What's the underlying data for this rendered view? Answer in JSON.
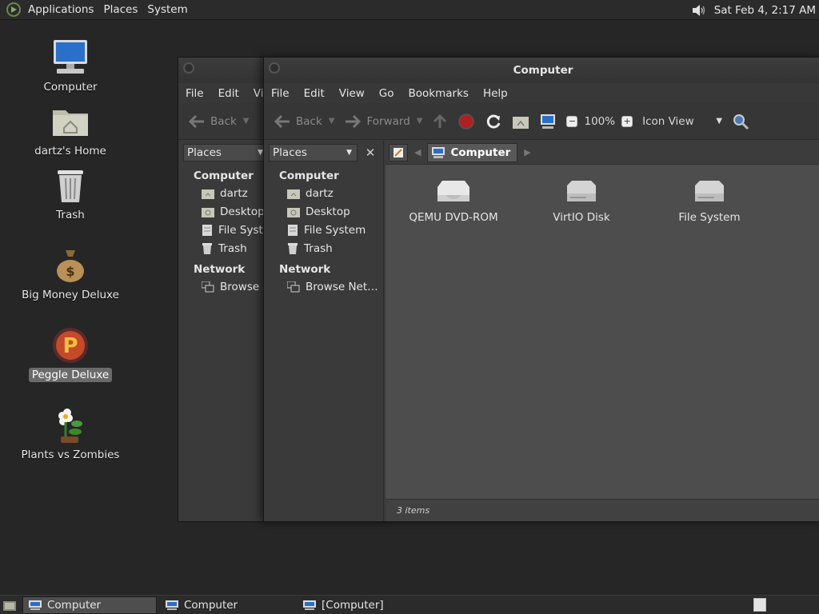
{
  "top_panel": {
    "menus": [
      "Applications",
      "Places",
      "System"
    ],
    "clock": "Sat Feb  4,  2:17 AM",
    "icons": {
      "logo": "distro-logo-icon",
      "volume": "volume-icon"
    }
  },
  "desktop_icons": [
    {
      "label": "Computer",
      "icon": "computer-icon"
    },
    {
      "label": "dartz's Home",
      "icon": "home-folder-icon"
    },
    {
      "label": "Trash",
      "icon": "trash-icon"
    },
    {
      "label": "Big Money Deluxe",
      "icon": "money-bag-icon"
    },
    {
      "label": "Peggle Deluxe",
      "icon": "peggle-icon",
      "selected": true
    },
    {
      "label": "Plants vs Zombies",
      "icon": "flower-icon"
    }
  ],
  "back_window": {
    "menu": [
      "File",
      "Edit",
      "Vi"
    ],
    "toolbar": {
      "back": "Back"
    },
    "places_label": "Places",
    "sidebar": {
      "heading_computer": "Computer",
      "items": [
        "dartz",
        "Desktop",
        "File Syste",
        "Trash"
      ],
      "heading_network": "Network",
      "network_item": "Browse N"
    }
  },
  "front_window": {
    "title": "Computer",
    "menu": [
      "File",
      "Edit",
      "View",
      "Go",
      "Bookmarks",
      "Help"
    ],
    "toolbar": {
      "back": "Back",
      "forward": "Forward",
      "zoom": "100%",
      "view_mode": "Icon View"
    },
    "places_label": "Places",
    "sidebar": {
      "heading_computer": "Computer",
      "items": [
        "dartz",
        "Desktop",
        "File System",
        "Trash"
      ],
      "heading_network": "Network",
      "network_item": "Browse Net…"
    },
    "breadcrumb": "Computer",
    "files": [
      "QEMU DVD-ROM",
      "VirtIO Disk",
      "File System"
    ],
    "status": "3 items"
  },
  "taskbar": {
    "tasks": [
      "Computer",
      "Computer",
      "[Computer]"
    ]
  }
}
